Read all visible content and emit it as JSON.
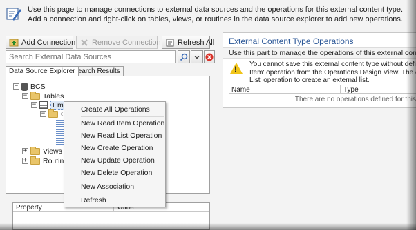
{
  "header": {
    "icon": "designer-pencil-icon",
    "text": "Use this page to manage connections to external data sources and the operations for this external content type. Add a connection and right-click on tables, views, or routines in the data source explorer to add new operations."
  },
  "toolbar": {
    "add_connection": "Add Connection",
    "remove_connection": "Remove Connection",
    "refresh_all": "Refresh All"
  },
  "search": {
    "placeholder": "Search External Data Sources"
  },
  "tabs": [
    {
      "label": "Data Source Explorer",
      "active": true
    },
    {
      "label": "Search Results",
      "active": false
    }
  ],
  "tree": {
    "bcs": "BCS",
    "tables": "Tables",
    "employee": "Emp",
    "child_folder": "C",
    "views": "Views",
    "routines": "Routin"
  },
  "context_menu": {
    "items": [
      "Create All Operations",
      "New Read Item Operation",
      "New Read List Operation",
      "New Create Operation",
      "New Update Operation",
      "New Delete Operation",
      "New Association",
      "Refresh"
    ]
  },
  "properties": {
    "col_property": "Property",
    "col_value": "Value"
  },
  "operations_panel": {
    "title": "External Content Type Operations",
    "description": "Use this part to manage the operations of this external content type.",
    "warning_lines": [
      "You cannot save this external content type without defining a",
      "Item' operation from the Operations Design View. The extern",
      "List' operation to create an external list."
    ],
    "col_name": "Name",
    "col_type": "Type",
    "empty_text": "There are no operations defined for this"
  },
  "colors": {
    "title_blue": "#2b5797",
    "warning_yellow": "#f0c419",
    "folder_yellow": "#e9c56a",
    "delete_red": "#d9342b"
  }
}
